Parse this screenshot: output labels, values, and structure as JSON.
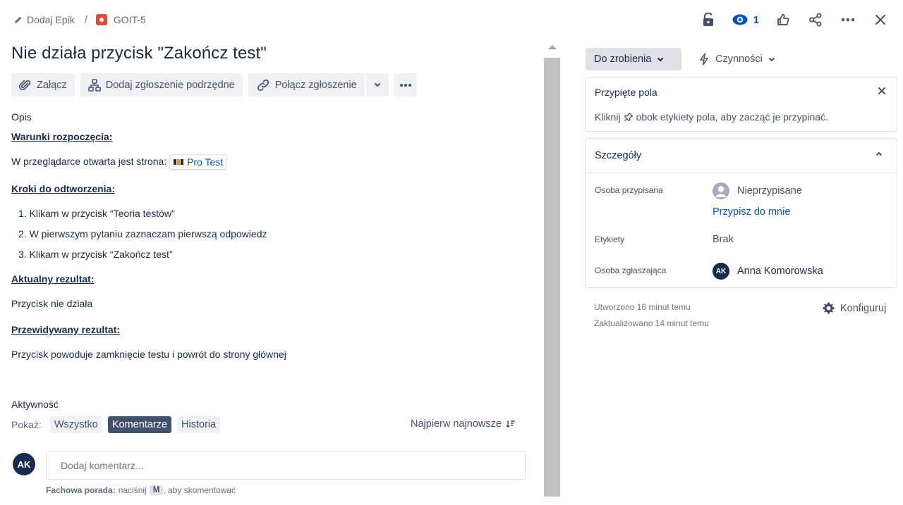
{
  "breadcrumb": {
    "epic_label": "Dodaj Epik",
    "separator": "/",
    "issue_key": "GOIT-5"
  },
  "top_actions": {
    "watch_count": "1",
    "icons": [
      "lock-icon",
      "eye-icon",
      "thumbs-up-icon",
      "share-icon",
      "more-icon",
      "close-icon"
    ]
  },
  "issue": {
    "title": "Nie działa przycisk \"Zakończ test\""
  },
  "toolbar": {
    "attach_label": "Załącz",
    "child_label": "Dodaj zgłoszenie podrzędne",
    "link_label": "Połącz zgłoszenie"
  },
  "description": {
    "label": "Opis",
    "preconditions_heading": "Warunki rozpoczęcia:",
    "preconditions_text": "W przeglądarce otwarta jest strona:",
    "smart_link_label": "Pro Test",
    "steps_heading": "Kroki do odtworzenia:",
    "steps": [
      "1. Klikam w przycisk “Teoria testów”",
      "2. W pierwszym pytaniu zaznaczam pierwszą odpowiedz",
      "3. Klikam w przycisk “Zakończ test”"
    ],
    "actual_heading": "Aktualny rezultat:",
    "actual_text": "Przycisk nie działa",
    "expected_heading": "Przewidywany rezultat:",
    "expected_text": "Przycisk powoduje zamknięcie testu i powrót do strony głównej"
  },
  "activity": {
    "title": "Aktywność",
    "show_label": "Pokaż:",
    "filters": [
      "Wszystko",
      "Komentarze",
      "Historia"
    ],
    "active_filter": "Komentarze",
    "sort_label": "Najpierw najnowsze",
    "user_initials": "AK",
    "comment_placeholder": "Dodaj komentarz...",
    "tip_prefix": "Fachowa porada:",
    "tip_mid": "naciśnij",
    "tip_key": "M",
    "tip_suffix": ", aby skomentować"
  },
  "sidebar": {
    "status_label": "Do zrobienia",
    "actions_label": "Czynności",
    "pinned": {
      "title": "Przypięte pola",
      "text_before": "Kliknij",
      "text_after": "obok etykiety pola, aby zacząć je przypinać."
    },
    "details": {
      "title": "Szczegóły",
      "assignee_label": "Osoba przypisana",
      "assignee_value": "Nieprzypisane",
      "assign_to_me": "Przypisz do mnie",
      "labels_label": "Etykiety",
      "labels_value": "Brak",
      "reporter_label": "Osoba zgłaszająca",
      "reporter_initials": "AK",
      "reporter_name": "Anna Komorowska"
    },
    "created": "Utworzono 16 minut temu",
    "updated": "Zaktualizowano 14 minut temu",
    "configure_label": "Konfiguruj"
  },
  "colors": {
    "link": "#0052cc",
    "bug": "#e5493a",
    "text": "#172b4d",
    "chip_active": "#42526e"
  }
}
